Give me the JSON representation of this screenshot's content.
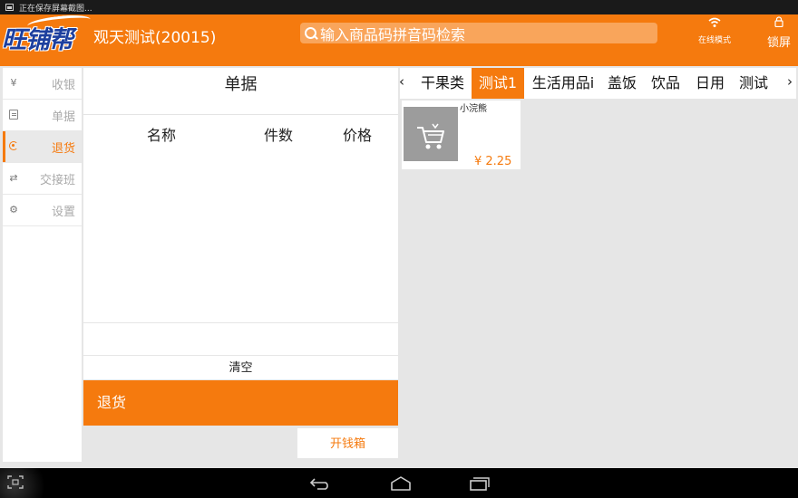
{
  "status_bar": {
    "notification_text": "正在保存屏幕截图..."
  },
  "header": {
    "logo_text": "旺铺帮",
    "store_name": "观天测试(20015)",
    "search_placeholder": "输入商品码拼音码检索",
    "online_label": "在线模式",
    "lock_label": "锁屏"
  },
  "sidebar": {
    "items": [
      {
        "icon": "yen-icon",
        "glyph": "¥",
        "label": "收银",
        "active": false
      },
      {
        "icon": "document-icon",
        "glyph": "",
        "label": "单据",
        "active": false
      },
      {
        "icon": "return-icon",
        "glyph": "",
        "label": "退货",
        "active": true
      },
      {
        "icon": "swap-icon",
        "glyph": "⇄",
        "label": "交接班",
        "active": false
      },
      {
        "icon": "gear-icon",
        "glyph": "⚙",
        "label": "设置",
        "active": false
      }
    ]
  },
  "receipt": {
    "title": "单据",
    "columns": {
      "name": "名称",
      "qty": "件数",
      "price": "价格"
    },
    "rows": []
  },
  "actions": {
    "clear_label": "清空",
    "return_label": "退货",
    "open_cash_label": "开钱箱"
  },
  "categories": {
    "prev_arrow": "‹",
    "next_arrow": "›",
    "tabs": [
      "干果类",
      "测试1",
      "生活用品i",
      "盖饭",
      "饮品",
      "日用",
      "测试"
    ],
    "active_index": 1
  },
  "products": [
    {
      "name": "小浣熊",
      "price": "¥ 2.25"
    }
  ],
  "colors": {
    "accent": "#f57a0e",
    "logo": "#1d3f9e",
    "background": "#e6e6e6"
  }
}
